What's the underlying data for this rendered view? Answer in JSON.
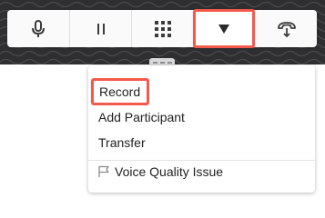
{
  "background": {
    "header_color": "#2f2f31",
    "pattern": "wavy-lines"
  },
  "toolbar": {
    "buttons": [
      {
        "name": "microphone-button",
        "icon": "microphone-icon"
      },
      {
        "name": "pause-button",
        "icon": "pause-icon"
      },
      {
        "name": "keypad-button",
        "icon": "keypad-grid-icon"
      },
      {
        "name": "more-options-button",
        "icon": "caret-down-icon",
        "highlighted": true
      },
      {
        "name": "hang-up-transfer-button",
        "icon": "handset-transfer-icon"
      }
    ]
  },
  "menu": {
    "items": [
      {
        "label": "Record",
        "highlighted": true
      },
      {
        "label": "Add Participant"
      },
      {
        "label": "Transfer"
      },
      {
        "label": "Voice Quality Issue",
        "icon": "flag-icon"
      }
    ]
  },
  "colors": {
    "highlight": "#f45a4b",
    "text": "#222222",
    "toolbar": "#fafafa",
    "icon": "#3c3c3c"
  }
}
